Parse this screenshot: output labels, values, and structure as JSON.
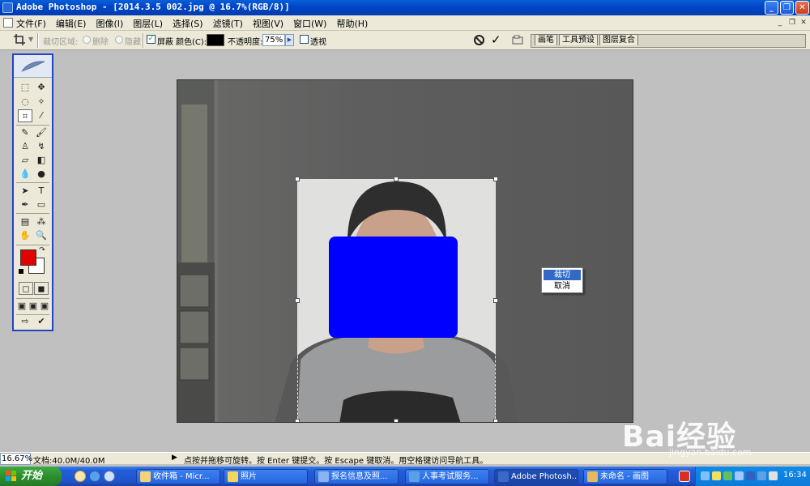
{
  "window": {
    "title": "Adobe Photoshop - [2014.3.5 002.jpg @ 16.7%(RGB/8)]"
  },
  "menubar": {
    "items": [
      "文件(F)",
      "编辑(E)",
      "图像(I)",
      "图层(L)",
      "选择(S)",
      "滤镜(T)",
      "视图(V)",
      "窗口(W)",
      "帮助(H)"
    ]
  },
  "options": {
    "crop_area_label": "裁切区域:",
    "delete_label": "删除",
    "hide_label": "隐藏",
    "shield_label": "屏蔽",
    "shield_checked": true,
    "color_label": "颜色(C):",
    "shield_color": "#000000",
    "opacity_label": "不透明度:",
    "opacity_value": "75%",
    "perspective_label": "透视",
    "perspective_checked": false
  },
  "palette_tabs": [
    "画笔",
    "工具预设",
    "图层复合"
  ],
  "toolbox": {
    "foreground_color": "#e30000",
    "background_color": "#ffffff",
    "active_tool": "crop-icon"
  },
  "document": {
    "redaction_color": "#0000ff"
  },
  "context_menu": {
    "items": [
      "裁切",
      "取消"
    ],
    "selected_index": 0
  },
  "statusbar": {
    "zoom": "16.67%",
    "doc_info": "文档:40.0M/40.0M",
    "message": "点按并拖移可旋转。按 Enter 键提交。按 Escape 键取消。用空格键访问导航工具。"
  },
  "taskbar": {
    "start_label": "开始",
    "tasks": [
      "收件箱 - Micr...",
      "照片",
      "报名信息及照...",
      "人事考试服务...",
      "Adobe Photosh...",
      "未命名 - 画图"
    ],
    "active_task_index": 4,
    "clock": "16:34"
  },
  "watermark": {
    "brand": "Bai经验",
    "url": "jingyan.baidu.com"
  }
}
